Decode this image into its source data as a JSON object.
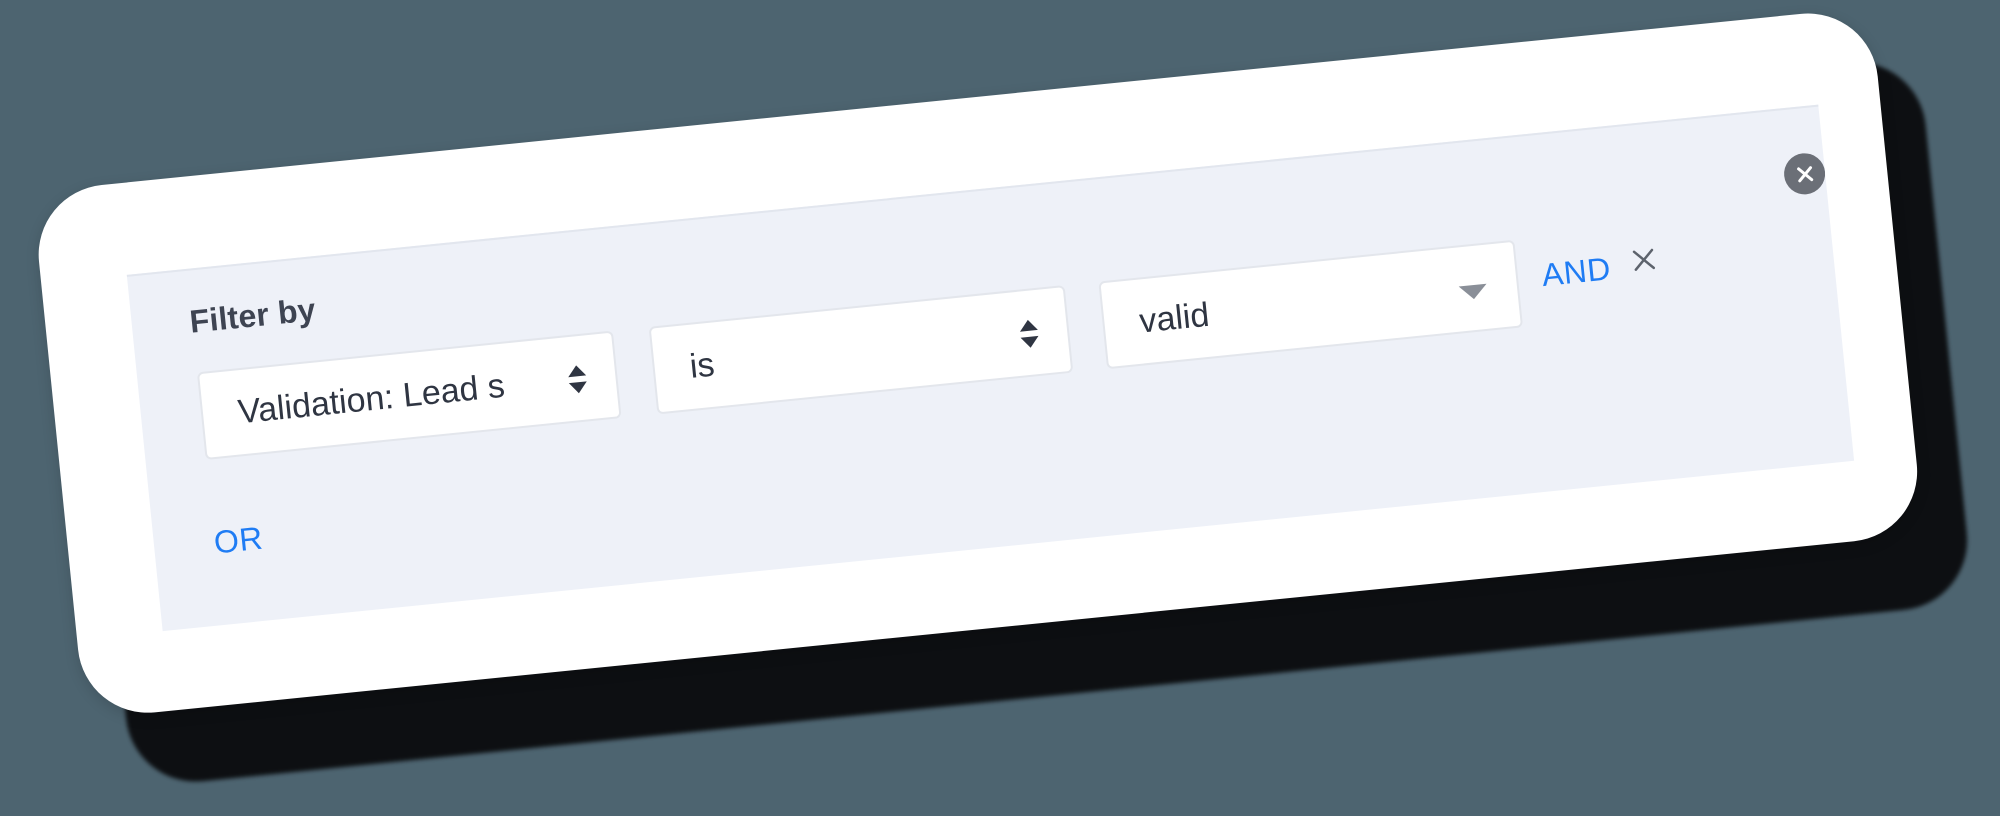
{
  "filter": {
    "title": "Filter by",
    "field_value": "Validation: Lead s",
    "operator_value": "is",
    "value_value": "valid",
    "and_label": "AND",
    "or_label": "OR"
  },
  "icons": {
    "close_panel": "close-circle-icon",
    "field_sort": "sort-updown-icon",
    "operator_sort": "sort-updown-icon",
    "value_dropdown": "caret-down-icon",
    "remove_row": "close-icon"
  },
  "colors": {
    "background": "#4d6470",
    "panel": "#eef1f8",
    "link": "#1f7cf4",
    "close_circle": "#6b6f77"
  }
}
